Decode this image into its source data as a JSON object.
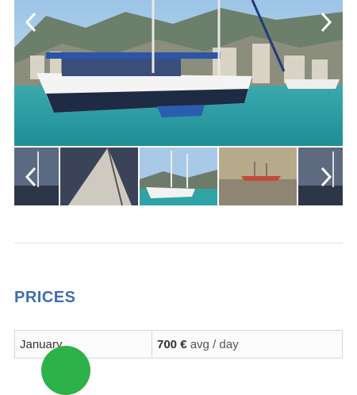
{
  "gallery": {
    "main_image_alt": "Gulet moored in a turquoise harbour",
    "prev_icon": "chevron-left-icon",
    "next_icon": "chevron-right-icon",
    "thumbnails": [
      "boat at dusk",
      "sail close-up",
      "boat in harbour",
      "boat at sea",
      "boat at dusk"
    ]
  },
  "prices": {
    "title": "PRICES",
    "rows": [
      {
        "month": "January",
        "amount": "700 €",
        "unit": "avg / day"
      }
    ]
  },
  "colors": {
    "accent": "#3e6db5",
    "badge": "#2db24a",
    "sea": "#2fa3a6"
  }
}
